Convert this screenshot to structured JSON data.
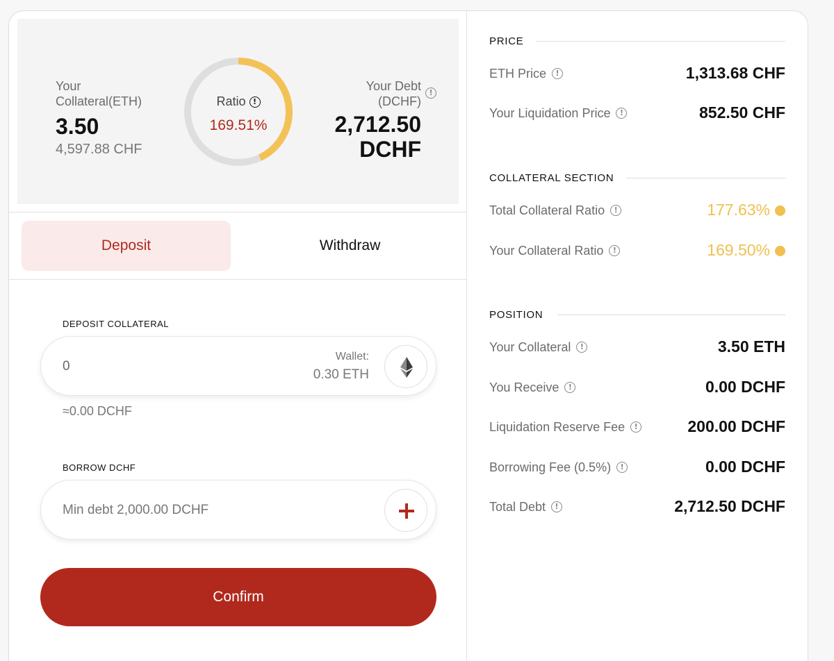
{
  "summary": {
    "collateral_label_1": "Your",
    "collateral_label_2": "Collateral(ETH)",
    "collateral_amount": "3.50",
    "collateral_value": "4,597.88 CHF",
    "ratio_label": "Ratio",
    "ratio_value": "169.51%",
    "ratio_fraction": 0.43,
    "debt_label_1": "Your Debt",
    "debt_label_2": "(DCHF)",
    "debt_amount_1": "2,712.50",
    "debt_amount_2": "DCHF"
  },
  "tabs": {
    "deposit": "Deposit",
    "withdraw": "Withdraw"
  },
  "deposit": {
    "title": "DEPOSIT COLLATERAL",
    "value": "0",
    "wallet_label": "Wallet:",
    "wallet_value": "0.30 ETH",
    "approx": "≈0.00 DCHF"
  },
  "borrow": {
    "title": "BORROW DCHF",
    "placeholder": "Min debt 2,000.00 DCHF"
  },
  "confirm_label": "Confirm",
  "price": {
    "heading": "PRICE",
    "eth_price_label": "ETH Price",
    "eth_price_value": "1,313.68 CHF",
    "liq_price_label": "Your Liquidation Price",
    "liq_price_value": "852.50 CHF"
  },
  "collateral_section": {
    "heading": "COLLATERAL SECTION",
    "total_ratio_label": "Total Collateral Ratio",
    "total_ratio_value": "177.63%",
    "your_ratio_label": "Your Collateral Ratio",
    "your_ratio_value": "169.50%"
  },
  "position": {
    "heading": "POSITION",
    "collateral_label": "Your Collateral",
    "collateral_value": "3.50 ETH",
    "receive_label": "You Receive",
    "receive_value": "0.00 DCHF",
    "reserve_label": "Liquidation Reserve Fee",
    "reserve_value": "200.00 DCHF",
    "borrow_fee_label": "Borrowing Fee (0.5%)",
    "borrow_fee_value": "0.00 DCHF",
    "total_debt_label": "Total Debt",
    "total_debt_value": "2,712.50 DCHF"
  },
  "colors": {
    "accent": "#b1291d",
    "warning": "#f0c050",
    "tab_active_bg": "#fbeaea"
  },
  "icons": {
    "info": "info-circle-icon",
    "eth": "ethereum-icon",
    "token": "dchf-token-icon"
  }
}
